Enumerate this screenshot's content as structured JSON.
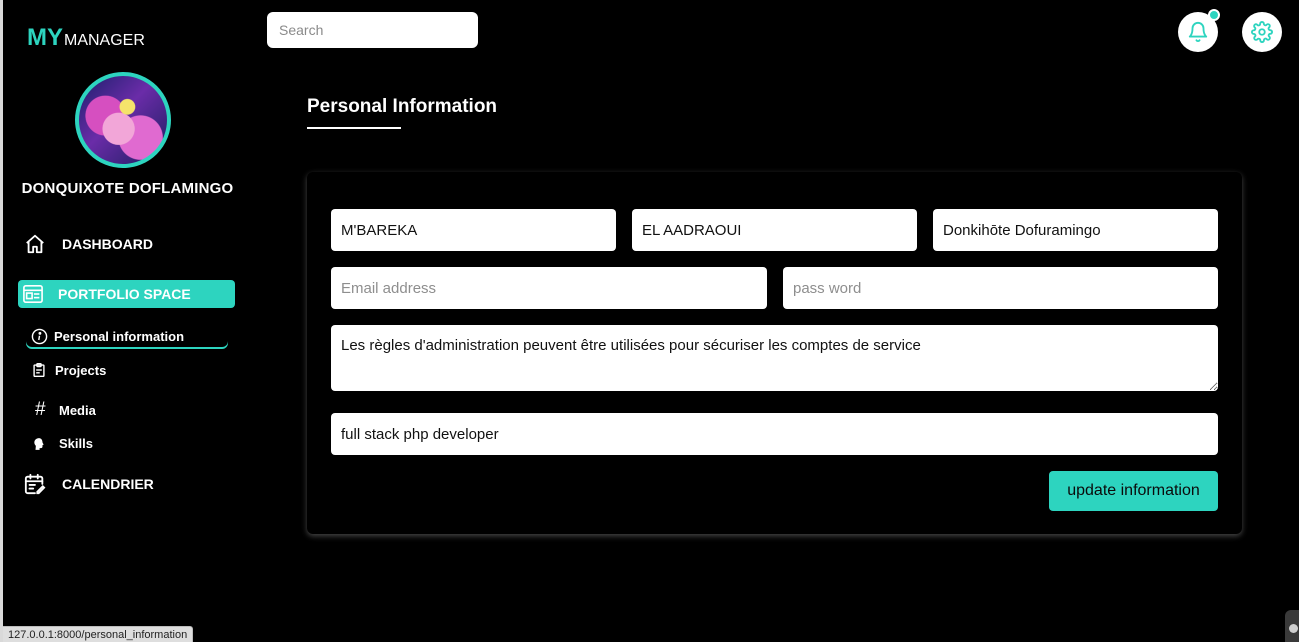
{
  "logo": {
    "my": "MY",
    "manager": "MANAGER"
  },
  "search": {
    "placeholder": "Search"
  },
  "header": {
    "notification_icon": "bell-icon",
    "settings_icon": "gear-icon",
    "accent": "#2dd4bf"
  },
  "profile": {
    "name": "DONQUIXOTE DOFLAMINGO"
  },
  "sidebar": {
    "dashboard": "DASHBOARD",
    "portfolio": "PORTFOLIO SPACE",
    "sub_items": {
      "personal": "Personal information",
      "projects": "Projects",
      "media": "Media",
      "skills": "Skills"
    },
    "calendar": "CALENDRIER"
  },
  "main": {
    "title": "Personal Information",
    "form": {
      "first_name": "M'BAREKA",
      "last_name": "EL AADRAOUI",
      "nickname": "Donkihōte Dofuramingo",
      "email_placeholder": "Email address",
      "password_placeholder": "pass word",
      "description": "Les règles d'administration peuvent être utilisées pour sécuriser les comptes de service",
      "job_title": "full stack php developer",
      "submit_label": "update information"
    }
  },
  "statusbar": {
    "url": "127.0.0.1:8000/personal_information"
  }
}
